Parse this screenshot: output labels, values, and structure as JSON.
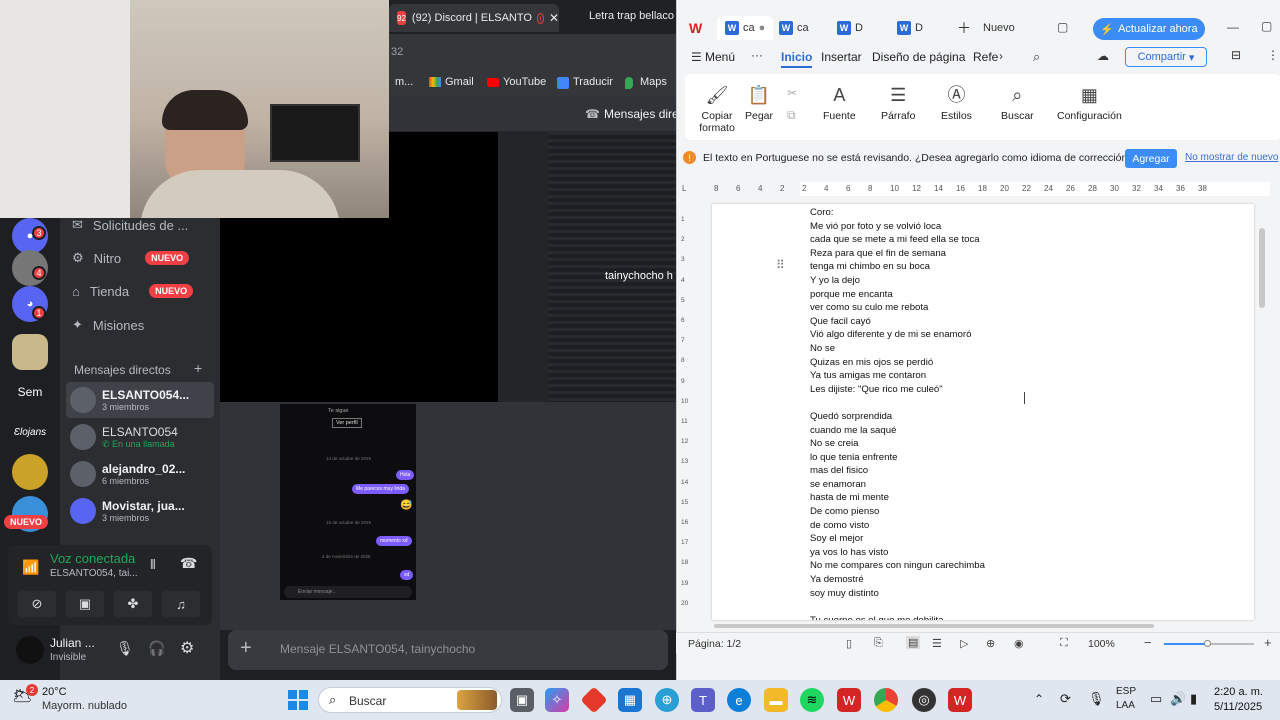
{
  "discord": {
    "webcam_label": "webcam",
    "chrome_tab_title": "(92) Discord | ELSANTO",
    "chrome_tab2_title": "Letra trap bellaco",
    "tab_count_fragment": "32",
    "bookmarks": [
      {
        "label": "m..."
      },
      {
        "label": "Gmail"
      },
      {
        "label": "YouTube"
      },
      {
        "label": "Traducir"
      },
      {
        "label": "Maps"
      }
    ],
    "mensajes_header": "Mensajes dire",
    "server_badges": [
      "3",
      "4",
      "1"
    ],
    "server_label_sem": "Sem",
    "server_label_logo": "Ɛlojans",
    "nuevo_badge": "NUEVO",
    "nav": {
      "solicitudes": "Solicitudes de ...",
      "nitro": "Nitro",
      "tienda": "Tienda",
      "misiones": "Misiones",
      "nuevo": "NUEVO"
    },
    "dm_header": "Mensajes directos",
    "dm_add": "+",
    "dms": [
      {
        "name": "ELSANTO054...",
        "sub": "3 miembros"
      },
      {
        "name": "ELSANTO054",
        "sub": "En una llamada"
      },
      {
        "name": "alejandro_02...",
        "sub": "6 miembros"
      },
      {
        "name": "Movistar, jua...",
        "sub": "3 miembros"
      }
    ],
    "voice": {
      "title": "Voz conectada",
      "sub": "ELSANTO054, tai..."
    },
    "user": {
      "name": "Julian ...",
      "status": "Invisible"
    },
    "stream_name": "tainychocho h",
    "phone": {
      "follow": "Te sigue",
      "profile": "Ver perfil",
      "date1": "14 de octubre de 2025",
      "msg1": "Hola",
      "msg2": "Me pareces muy linda",
      "date2": "15 de octubre de 2025",
      "msg3": "momento xd",
      "date3": "4 de noviembre de 2025",
      "msg4": "xd",
      "input": "Enviar mensaje..."
    },
    "message_placeholder": "Mensaje ELSANTO054, tainychocho"
  },
  "wps": {
    "tabs": [
      "ca",
      "ca",
      "D",
      "D"
    ],
    "nuevo": "Nuevo",
    "update_button": "Actualizar ahora",
    "menu": [
      "Menú",
      "Inicio",
      "Insertar",
      "Diseño de página",
      "Refe"
    ],
    "compartir": "Compartir",
    "tools": [
      {
        "label": "Copiar formato"
      },
      {
        "label": "Pegar"
      },
      {
        "label": "Fuente"
      },
      {
        "label": "Párrafo"
      },
      {
        "label": "Estilos"
      },
      {
        "label": "Buscar"
      },
      {
        "label": "Configuración"
      }
    ],
    "notice": "El texto en Portuguese no se está revisando. ¿Desea agregarlo como idioma de corrección?",
    "agregar": "Agregar",
    "no_mostrar": "No mostrar de nuevo",
    "ruler_numbers": [
      "8",
      "6",
      "4",
      "2",
      "2",
      "4",
      "6",
      "8",
      "10",
      "12",
      "14",
      "16",
      "18",
      "20",
      "22",
      "24",
      "26",
      "28",
      "30",
      "32",
      "34",
      "36",
      "38"
    ],
    "vruler_numbers": [
      "1",
      "2",
      "3",
      "4",
      "5",
      "6",
      "7",
      "8",
      "9",
      "10",
      "11",
      "12",
      "13",
      "14",
      "15",
      "16",
      "17",
      "18",
      "19",
      "20"
    ],
    "lyrics": [
      "Coro:",
      "Me vió por foto y se volvió loca",
      "cada que se mete a mi feed ella se toca",
      "Reza para que el fin de semana",
      "tenga mi chimbo en su boca",
      "Y yo la dejo",
      "porque me encanta",
      "ver como su culo me rebota",
      "Que facil cayó",
      "Vió algo diferente y de mi se enamoró",
      "No se",
      "Quizas en mis ojos se perdió",
      "Ya tus amigas me contaron",
      "Les dijiste: \"Que rico me culeó\"",
      "",
      "Quedó sorprendida",
      "cuando me la saqué",
      "No se creia",
      "lo que tenia enfrente",
      "mas del fisico",
      "se enamoran",
      " hasta de mi mente",
      "De como pienso",
      "de como visto",
      "Soy el mejor",
      " ya vos lo has visto",
      "No me compares con ningun carechimba",
      "Ya demostré",
      "soy muy distinto",
      "",
      "Tu cuerpo es el que me debilita"
    ],
    "page_indicator": "Página: 1/2",
    "zoom": "100%"
  },
  "taskbar": {
    "weather_temp": "20°C",
    "weather_desc": "Mayorm. nublado",
    "weather_badge": "2",
    "search": "Buscar",
    "lang1": "ESP",
    "lang2": "LAA",
    "time": "2:20 a. m.",
    "date": "5/11/2025"
  }
}
